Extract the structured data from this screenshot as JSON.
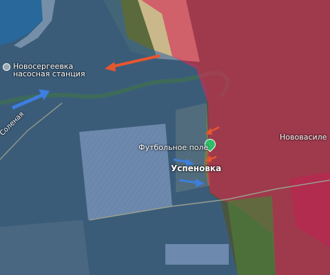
{
  "map": {
    "labels": {
      "pump_station_line1": "Новосергеевка",
      "pump_station_line2": "насосная станция",
      "road": "Соленая",
      "football_field": "Футбольное поле",
      "uspenovka": "Успеновка",
      "novovasilevka": "Нововасиле"
    },
    "colors": {
      "blue_zone": "#3a6fb0",
      "red_zone": "#d42a55",
      "blue_arrow": "#3d7ee0",
      "red_arrow": "#e8562e",
      "poi_pin": "#2fbf6a"
    }
  }
}
